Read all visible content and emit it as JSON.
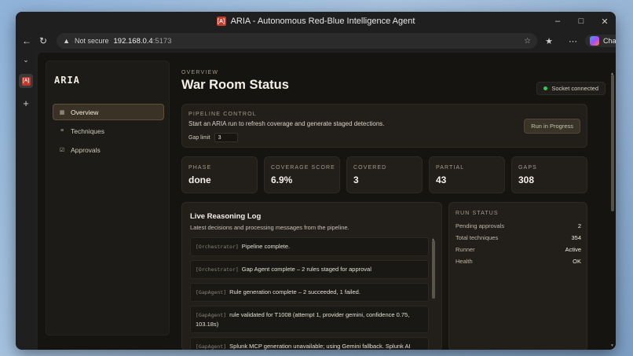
{
  "window": {
    "badge": "[A]",
    "title": "ARIA - Autonomous Red-Blue Intelligence Agent"
  },
  "addressbar": {
    "security_label": "Not secure",
    "host": "192.168.0.4",
    "port": ":5173",
    "chat_label": "Chat"
  },
  "tabs": {
    "active_badge": "[A]"
  },
  "sidebar": {
    "brand": "ARIA",
    "items": [
      {
        "label": "Overview",
        "icon": "grid-icon",
        "active": true
      },
      {
        "label": "Techniques",
        "icon": "list-icon",
        "active": false
      },
      {
        "label": "Approvals",
        "icon": "checkbox-icon",
        "active": false
      }
    ]
  },
  "header": {
    "eyebrow": "OVERVIEW",
    "title": "War Room Status",
    "socket_status": "Socket connected",
    "socket_color": "#34c759"
  },
  "pipeline": {
    "label": "PIPELINE CONTROL",
    "description": "Start an ARIA run to refresh coverage and generate staged detections.",
    "gap_limit_label": "Gap limit",
    "gap_limit_value": "3",
    "run_button": "Run in Progress"
  },
  "stats": [
    {
      "label": "PHASE",
      "value": "done"
    },
    {
      "label": "COVERAGE SCORE",
      "value": "6.9%"
    },
    {
      "label": "COVERED",
      "value": "3"
    },
    {
      "label": "PARTIAL",
      "value": "43"
    },
    {
      "label": "GAPS",
      "value": "308"
    }
  ],
  "log": {
    "title": "Live Reasoning Log",
    "subtitle": "Latest decisions and processing messages from the pipeline.",
    "entries": [
      {
        "source": "[Orchestrator]",
        "message": "Pipeline complete."
      },
      {
        "source": "[Orchestrator]",
        "message": "Gap Agent complete – 2 rules staged for approval"
      },
      {
        "source": "[GapAgent]",
        "message": "Rule generation complete – 2 succeeded, 1 failed."
      },
      {
        "source": "[GapAgent]",
        "message": "rule validated for T1008 (attempt 1, provider gemini, confidence 0.75, 103.18s)"
      },
      {
        "source": "[GapAgent]",
        "message": "Splunk MCP generation unavailable; using Gemini fallback. Splunk AI Assistant tool returned an internal configuration error."
      }
    ]
  },
  "run_status": {
    "label": "RUN STATUS",
    "rows": [
      {
        "key": "Pending approvals",
        "value": "2"
      },
      {
        "key": "Total techniques",
        "value": "354"
      },
      {
        "key": "Runner",
        "value": "Active"
      },
      {
        "key": "Health",
        "value": "OK"
      }
    ]
  }
}
